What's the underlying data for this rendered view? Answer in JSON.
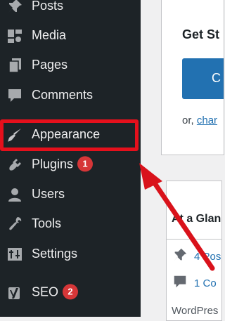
{
  "sidebar": {
    "items": [
      {
        "label": "Posts",
        "icon": "pin-icon"
      },
      {
        "label": "Media",
        "icon": "media-icon"
      },
      {
        "label": "Pages",
        "icon": "pages-icon"
      },
      {
        "label": "Comments",
        "icon": "comment-icon"
      },
      {
        "label": "Appearance",
        "icon": "paintbrush-icon"
      },
      {
        "label": "Plugins",
        "icon": "plug-icon",
        "badge": "1"
      },
      {
        "label": "Users",
        "icon": "user-icon"
      },
      {
        "label": "Tools",
        "icon": "wrench-icon"
      },
      {
        "label": "Settings",
        "icon": "settings-icon"
      },
      {
        "label": "SEO",
        "icon": "yoast-icon",
        "badge": "2"
      }
    ]
  },
  "welcome_panel": {
    "heading": "Get St",
    "button_label": "C",
    "text_prefix": "or, ",
    "link_text": "char"
  },
  "at_a_glance": {
    "title": "At a Glan",
    "posts_text": "4 Pos",
    "comments_text": "1 Co",
    "footer_text": "WordPres"
  },
  "colors": {
    "sidebar_bg": "#1d2327",
    "highlight_red": "#e5101c",
    "badge_red": "#d63638",
    "wp_blue": "#2271b1"
  }
}
